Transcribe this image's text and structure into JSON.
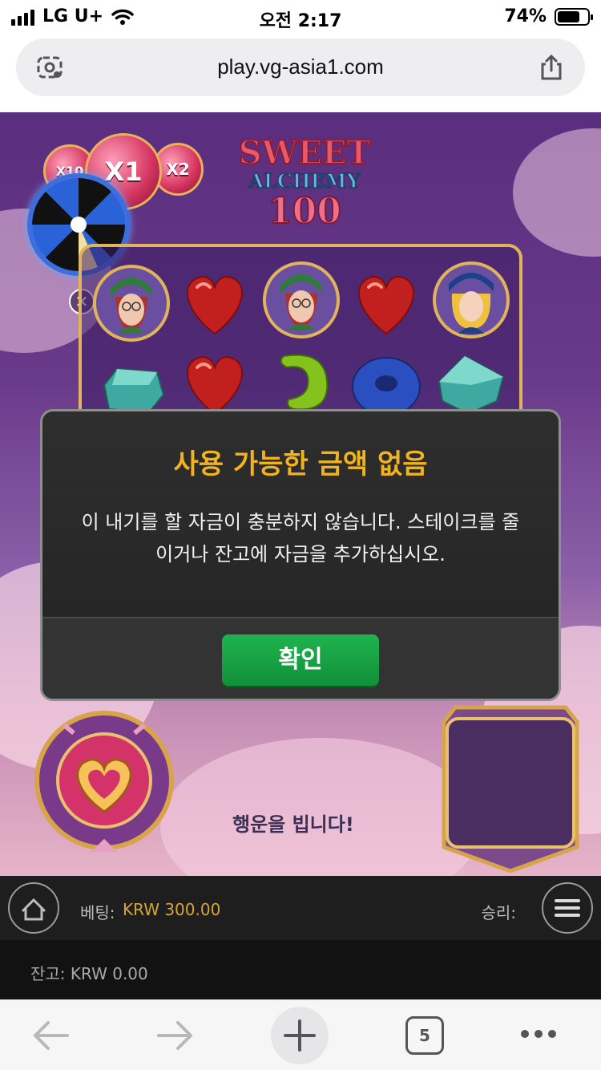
{
  "status_bar": {
    "carrier": "LG U+",
    "time": "오전 2:17",
    "battery_percent": "74%",
    "battery_level": 0.74,
    "icons": [
      "signal-icon",
      "wifi-icon",
      "battery-icon"
    ]
  },
  "browser": {
    "url": "play.vg-asia1.com",
    "tab_count": "5",
    "icons": [
      "reader-icon",
      "share-icon",
      "back-icon",
      "forward-icon",
      "plus-icon",
      "tabs-icon",
      "more-icon"
    ]
  },
  "game": {
    "multipliers": [
      "X10",
      "X1",
      "X2"
    ],
    "behind_text": "행운을 빕니다!"
  },
  "dialog": {
    "title": "사용 가능한 금액 없음",
    "message_line1": "이 내기를 할 자금이 충분하지 않습니다. 스테이크를 줄",
    "message_line2": "이거나 잔고에 자금을 추가하십시오.",
    "confirm_label": "확인"
  },
  "bet_bar": {
    "bet_label": "베팅:",
    "bet_value": "KRW 300.00",
    "win_label": "승리:"
  },
  "balance": {
    "text": "잔고: KRW 0.00"
  },
  "colors": {
    "dialog_title": "#f2b320",
    "confirm_green": "#1fb34e",
    "bet_value": "#d4a53a",
    "game_bg": "#5a2d7e"
  }
}
